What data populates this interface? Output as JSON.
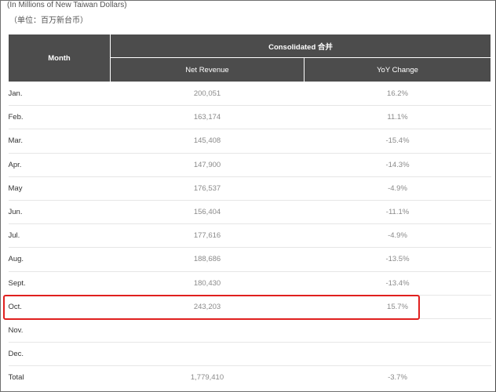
{
  "notes": {
    "unit_en": "(In Millions of New Taiwan Dollars)",
    "unit_zh": "（单位：百万新台币）"
  },
  "table": {
    "header_month": "Month",
    "header_group": "Consolidated 合并",
    "header_revenue": "Net Revenue",
    "header_yoy": "YoY Change",
    "rows": [
      {
        "month": "Jan.",
        "revenue": "200,051",
        "yoy": "16.2%"
      },
      {
        "month": "Feb.",
        "revenue": "163,174",
        "yoy": "11.1%"
      },
      {
        "month": "Mar.",
        "revenue": "145,408",
        "yoy": "-15.4%"
      },
      {
        "month": "Apr.",
        "revenue": "147,900",
        "yoy": "-14.3%"
      },
      {
        "month": "May",
        "revenue": "176,537",
        "yoy": "-4.9%"
      },
      {
        "month": "Jun.",
        "revenue": "156,404",
        "yoy": "-11.1%"
      },
      {
        "month": "Jul.",
        "revenue": "177,616",
        "yoy": "-4.9%"
      },
      {
        "month": "Aug.",
        "revenue": "188,686",
        "yoy": "-13.5%"
      },
      {
        "month": "Sept.",
        "revenue": "180,430",
        "yoy": "-13.4%"
      },
      {
        "month": "Oct.",
        "revenue": "243,203",
        "yoy": "15.7%"
      },
      {
        "month": "Nov.",
        "revenue": "",
        "yoy": ""
      },
      {
        "month": "Dec.",
        "revenue": "",
        "yoy": ""
      },
      {
        "month": "Total",
        "revenue": "1,779,410",
        "yoy": "-3.7%"
      }
    ]
  },
  "highlight": {
    "row_month": "Oct.",
    "color": "#e0201f"
  }
}
